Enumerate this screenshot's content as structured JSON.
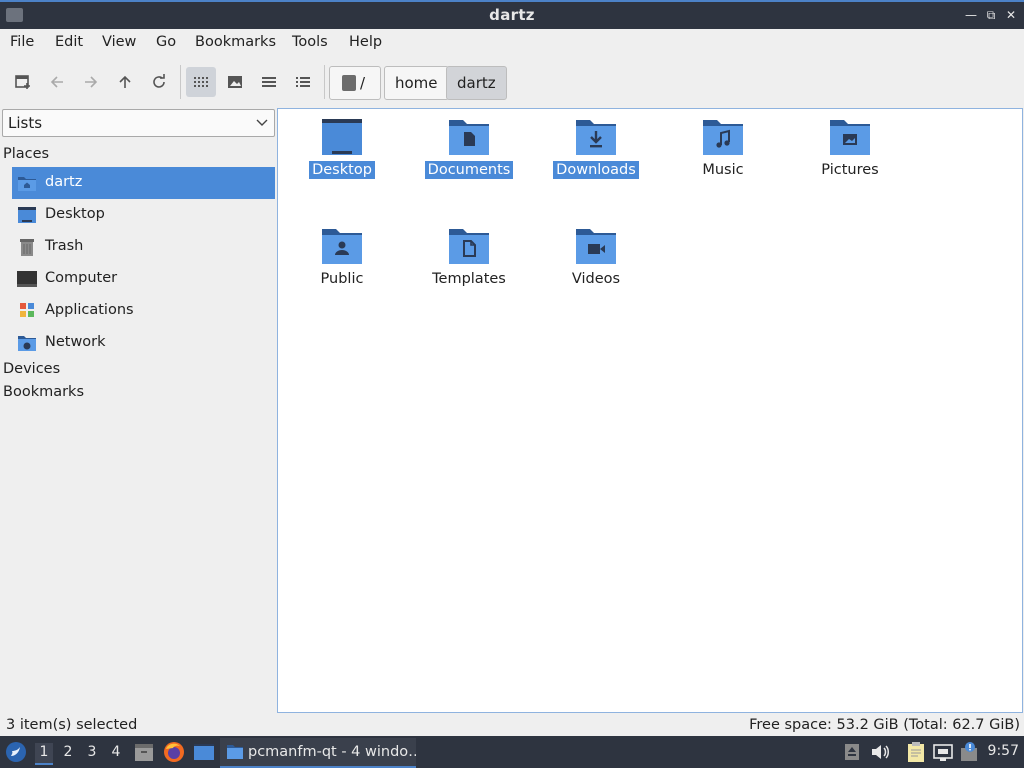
{
  "window": {
    "title": "dartz"
  },
  "menu": [
    "File",
    "Edit",
    "View",
    "Go",
    "Bookmarks",
    "Tools",
    "Help"
  ],
  "toolbar": {
    "buttons": [
      "new-tab-icon",
      "back-arrow-icon",
      "forward-arrow-icon",
      "up-arrow-icon",
      "reload-icon",
      "icon-view-icon",
      "thumbnail-view-icon",
      "compact-view-icon",
      "detailed-list-view-icon"
    ],
    "active_view": "icon-view",
    "breadcrumbs": [
      "/",
      "home",
      "dartz"
    ]
  },
  "sidebar": {
    "combo": "Lists",
    "places_header": "Places",
    "places": [
      {
        "label": "dartz",
        "icon": "home-folder-icon",
        "selected": true
      },
      {
        "label": "Desktop",
        "icon": "desktop-folder-icon"
      },
      {
        "label": "Trash",
        "icon": "trash-icon"
      },
      {
        "label": "Computer",
        "icon": "computer-icon"
      },
      {
        "label": "Applications",
        "icon": "applications-icon"
      },
      {
        "label": "Network",
        "icon": "network-icon"
      }
    ],
    "devices_header": "Devices",
    "bookmarks_header": "Bookmarks"
  },
  "files": [
    {
      "name": "Desktop",
      "icon": "desktop-folder-icon",
      "selected": true
    },
    {
      "name": "Documents",
      "icon": "documents-folder-icon",
      "selected": true
    },
    {
      "name": "Downloads",
      "icon": "downloads-folder-icon",
      "selected": true
    },
    {
      "name": "Music",
      "icon": "music-folder-icon",
      "selected": false
    },
    {
      "name": "Pictures",
      "icon": "pictures-folder-icon",
      "selected": false
    },
    {
      "name": "Public",
      "icon": "public-folder-icon",
      "selected": false
    },
    {
      "name": "Templates",
      "icon": "templates-folder-icon",
      "selected": false
    },
    {
      "name": "Videos",
      "icon": "videos-folder-icon",
      "selected": false
    }
  ],
  "status": {
    "selected": "3 item(s) selected",
    "free_space": "Free space: 53.2 GiB (Total: 62.7 GiB)"
  },
  "taskbar": {
    "workspaces": [
      "1",
      "2",
      "3",
      "4"
    ],
    "active_workspace": "1",
    "task_label": "pcmanfm-qt - 4 windo…",
    "clock": "9:57"
  },
  "colors": {
    "accent": "#4a8ad8",
    "folder": "#4a8ad8",
    "folder_dark": "#2d5a96",
    "titlebar": "#2e3440"
  }
}
